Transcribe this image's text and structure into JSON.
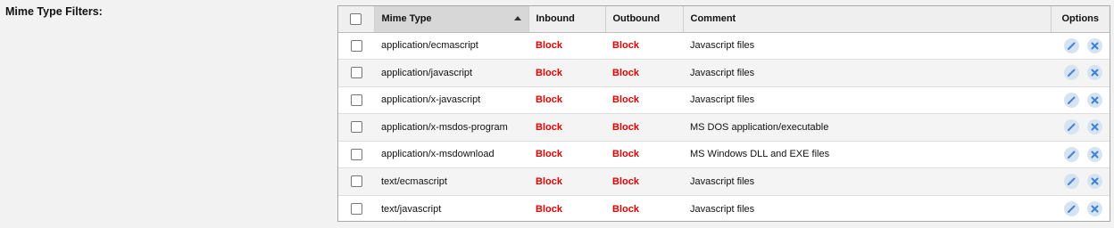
{
  "section": {
    "label": "Mime Type Filters:"
  },
  "table": {
    "headers": {
      "mime_type": "Mime Type",
      "inbound": "Inbound",
      "outbound": "Outbound",
      "comment": "Comment",
      "options": "Options"
    },
    "sort": {
      "column": "mime_type",
      "direction": "ascending"
    },
    "rows": [
      {
        "mime_type": "application/ecmascript",
        "inbound": "Block",
        "outbound": "Block",
        "comment": "Javascript files"
      },
      {
        "mime_type": "application/javascript",
        "inbound": "Block",
        "outbound": "Block",
        "comment": "Javascript files"
      },
      {
        "mime_type": "application/x-javascript",
        "inbound": "Block",
        "outbound": "Block",
        "comment": "Javascript files"
      },
      {
        "mime_type": "application/x-msdos-program",
        "inbound": "Block",
        "outbound": "Block",
        "comment": "MS DOS application/executable"
      },
      {
        "mime_type": "application/x-msdownload",
        "inbound": "Block",
        "outbound": "Block",
        "comment": "MS Windows DLL and EXE files"
      },
      {
        "mime_type": "text/ecmascript",
        "inbound": "Block",
        "outbound": "Block",
        "comment": "Javascript files"
      },
      {
        "mime_type": "text/javascript",
        "inbound": "Block",
        "outbound": "Block",
        "comment": "Javascript files"
      }
    ],
    "row_icons": [
      "edit-icon",
      "delete-icon"
    ]
  },
  "colors": {
    "block_text": "#e00000",
    "header_bg": "#efefef",
    "sorted_header_bg": "#d7d7d7",
    "icon_bg": "#d6e4f2",
    "icon_fg": "#4a7fd1"
  }
}
